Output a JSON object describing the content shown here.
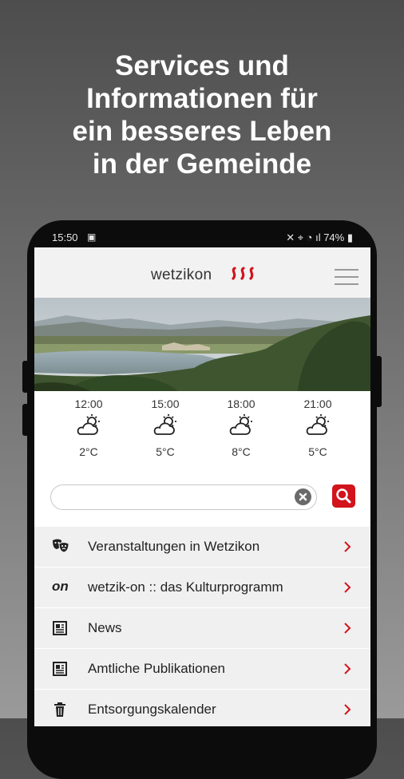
{
  "headline": [
    "Services und",
    "Informationen für",
    "ein besseres Leben",
    "in der Gemeinde"
  ],
  "status": {
    "time": "15:50",
    "battery": "74%"
  },
  "app": {
    "logo": "wetzikon",
    "brand_color": "#d2141c"
  },
  "weather": [
    {
      "time": "12:00",
      "temp": "2°C",
      "icon": "partly-cloudy-icon"
    },
    {
      "time": "15:00",
      "temp": "5°C",
      "icon": "partly-cloudy-icon"
    },
    {
      "time": "18:00",
      "temp": "8°C",
      "icon": "partly-cloudy-icon"
    },
    {
      "time": "21:00",
      "temp": "5°C",
      "icon": "partly-cloudy-icon"
    }
  ],
  "search": {
    "value": "",
    "placeholder": ""
  },
  "menu_items": [
    {
      "label": "Veranstaltungen in Wetzikon",
      "icon": "theater-masks-icon"
    },
    {
      "label": "wetzik-on :: das Kulturprogramm",
      "icon_text": "on"
    },
    {
      "label": "News",
      "icon": "newspaper-icon"
    },
    {
      "label": "Amtliche Publikationen",
      "icon": "newspaper-icon"
    },
    {
      "label": "Entsorgungskalender",
      "icon": "trash-icon"
    }
  ]
}
